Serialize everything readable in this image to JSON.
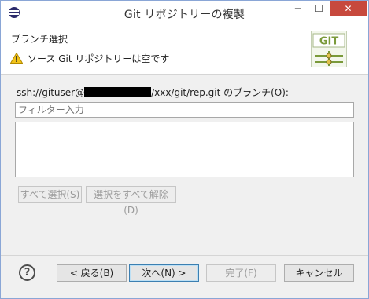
{
  "window": {
    "title": "Git リポジトリーの複製",
    "minimize_glyph": "─",
    "maximize_glyph": "☐",
    "close_glyph": "✕"
  },
  "header": {
    "page_title": "ブランチ選択",
    "status_message": "ソース Git リポジトリーは空です",
    "warning_icon": "warning-triangle-icon",
    "logo_text": "GIT"
  },
  "content": {
    "remote_prefix": "ssh://gituser@",
    "remote_suffix": "/xxx/git/rep.git のブランチ(O):",
    "filter_placeholder": "フィルター入力",
    "branches": [],
    "select_all_label": "すべて選択(S)",
    "deselect_all_label": "選択をすべて解除(D)"
  },
  "footer": {
    "help_glyph": "?",
    "back_label": "< 戻る(B)",
    "next_label": "次へ(N) >",
    "finish_label": "完了(F)",
    "cancel_label": "キャンセル"
  },
  "colors": {
    "close_button": "#c7493d",
    "default_button_border": "#3c7fb1",
    "logo_green": "#7a9a3a",
    "warning_yellow": "#f2c318"
  }
}
